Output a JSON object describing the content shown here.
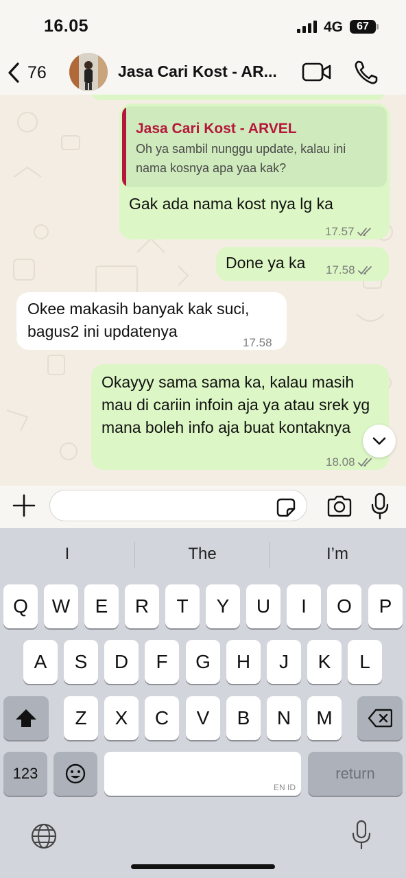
{
  "status": {
    "time": "16.05",
    "network": "4G",
    "battery": "67"
  },
  "header": {
    "back_count": "76",
    "contact_name": "Jasa Cari Kost - AR..."
  },
  "messages": [
    {
      "quote_name": "Jasa Cari Kost - ARVEL",
      "quote_text": "Oh ya sambil nunggu update, kalau ini nama kosnya apa yaa kak?",
      "text": "Gak ada nama kost nya lg ka",
      "time": "17.57"
    },
    {
      "text": "Done ya ka",
      "time": "17.58"
    },
    {
      "text": "Okee makasih banyak kak suci, bagus2 ini updatenya",
      "time": "17.58"
    },
    {
      "text": "Okayyy sama sama ka, kalau masih mau di cariin infoin aja ya atau srek yg mana boleh info aja buat kontaknya",
      "time": "18.08"
    }
  ],
  "keyboard": {
    "suggestions": [
      "I",
      "The",
      "I’m"
    ],
    "row1": [
      "Q",
      "W",
      "E",
      "R",
      "T",
      "Y",
      "U",
      "I",
      "O",
      "P"
    ],
    "row2": [
      "A",
      "S",
      "D",
      "F",
      "G",
      "H",
      "J",
      "K",
      "L"
    ],
    "row3": [
      "Z",
      "X",
      "C",
      "V",
      "B",
      "N",
      "M"
    ],
    "numbers_label": "123",
    "space_hint": "EN ID",
    "return_label": "return"
  },
  "colors": {
    "outgoing": "#dcf7c5",
    "incoming": "#ffffff",
    "quote_accent": "#b5173a",
    "chat_bg": "#f3ede3",
    "keyboard_bg": "#d2d5db"
  }
}
